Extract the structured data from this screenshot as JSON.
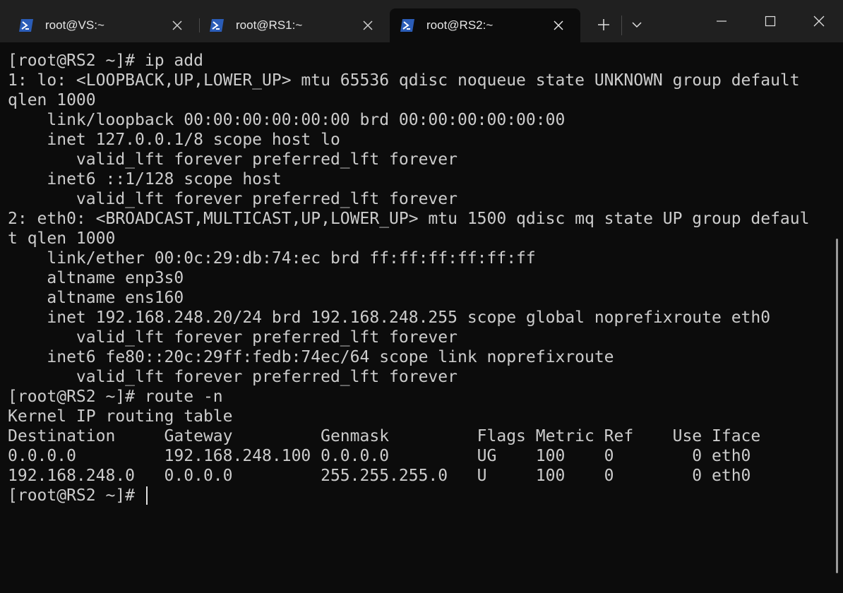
{
  "tabs": [
    {
      "label": "root@VS:~",
      "active": false
    },
    {
      "label": "root@RS1:~",
      "active": false
    },
    {
      "label": "root@RS2:~",
      "active": true
    }
  ],
  "tab_icon": "powershell-icon",
  "window_controls": [
    "minimize-icon",
    "maximize-icon",
    "close-icon"
  ],
  "new_tab_icon": "plus-icon",
  "dropdown_icon": "chevron-down-icon",
  "colors": {
    "terminal_bg": "#0c0c0c",
    "titlebar_bg": "#202020",
    "text": "#cccccc",
    "icon_blue": "#2b5db8"
  },
  "terminal": {
    "lines": [
      "[root@RS2 ~]# ip add",
      "1: lo: <LOOPBACK,UP,LOWER_UP> mtu 65536 qdisc noqueue state UNKNOWN group default",
      "qlen 1000",
      "    link/loopback 00:00:00:00:00:00 brd 00:00:00:00:00:00",
      "    inet 127.0.0.1/8 scope host lo",
      "       valid_lft forever preferred_lft forever",
      "    inet6 ::1/128 scope host",
      "       valid_lft forever preferred_lft forever",
      "2: eth0: <BROADCAST,MULTICAST,UP,LOWER_UP> mtu 1500 qdisc mq state UP group defaul",
      "t qlen 1000",
      "    link/ether 00:0c:29:db:74:ec brd ff:ff:ff:ff:ff:ff",
      "    altname enp3s0",
      "    altname ens160",
      "    inet 192.168.248.20/24 brd 192.168.248.255 scope global noprefixroute eth0",
      "       valid_lft forever preferred_lft forever",
      "    inet6 fe80::20c:29ff:fedb:74ec/64 scope link noprefixroute",
      "       valid_lft forever preferred_lft forever",
      "[root@RS2 ~]# route -n",
      "Kernel IP routing table",
      "Destination     Gateway         Genmask         Flags Metric Ref    Use Iface",
      "0.0.0.0         192.168.248.100 0.0.0.0         UG    100    0        0 eth0",
      "192.168.248.0   0.0.0.0         255.255.255.0   U     100    0        0 eth0"
    ],
    "prompt": "[root@RS2 ~]# "
  }
}
